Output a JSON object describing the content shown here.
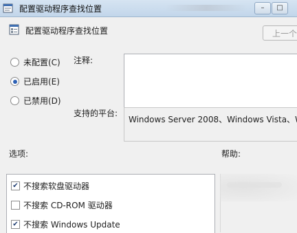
{
  "window": {
    "title": "配置驱动程序查找位置"
  },
  "header": {
    "title": "配置驱动程序查找位置",
    "prev_button": "上一个"
  },
  "radio_options": [
    {
      "label": "未配置(C)",
      "checked": false
    },
    {
      "label": "已启用(E)",
      "checked": true
    },
    {
      "label": "已禁用(D)",
      "checked": false
    }
  ],
  "notes": {
    "label": "注释:",
    "value": ""
  },
  "platform": {
    "label": "支持的平台:",
    "value": "Windows Server 2008、Windows Vista、W"
  },
  "options": {
    "label": "选项:",
    "items": [
      {
        "label": "不搜索软盘驱动器",
        "checked": true
      },
      {
        "label": "不搜索 CD-ROM 驱动器",
        "checked": false
      },
      {
        "label": "不搜索 Windows Update",
        "checked": true
      }
    ]
  },
  "help": {
    "label": "帮助:"
  },
  "colors": {
    "radio_accent": "#2d61b5",
    "titlebar": "#c9dbee"
  },
  "icons": {
    "app": "policy-icon",
    "header": "policy-setting-icon"
  }
}
